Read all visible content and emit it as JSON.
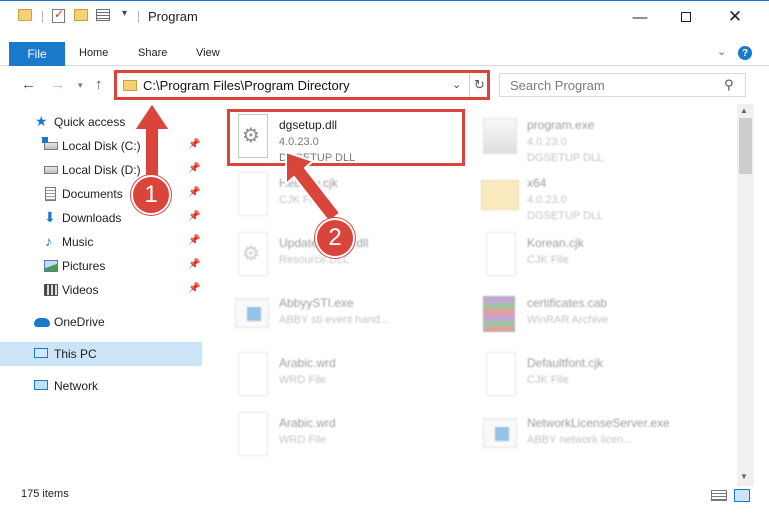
{
  "window": {
    "title": "Program",
    "minimize_glyph": "—",
    "close_glyph": "✕"
  },
  "ribbon": {
    "tabs": [
      "File",
      "Home",
      "Share",
      "View"
    ],
    "help_glyph": "?",
    "collapse_glyph": "⌄"
  },
  "address": {
    "path": "C:\\Program Files\\Program Directory",
    "search_placeholder": "Search Program"
  },
  "nav": {
    "back": "←",
    "forward": "→",
    "up": "↑",
    "items": [
      {
        "label": "Quick access",
        "icon": "star-icon"
      },
      {
        "label": "Local Disk (C:)",
        "icon": "drive-icon",
        "pinned": true
      },
      {
        "label": "Local Disk (D:)",
        "icon": "drive-icon",
        "pinned": true
      },
      {
        "label": "Documents",
        "icon": "documents-icon",
        "pinned": true
      },
      {
        "label": "Downloads",
        "icon": "download-icon",
        "pinned": true
      },
      {
        "label": "Music",
        "icon": "music-icon",
        "pinned": true
      },
      {
        "label": "Pictures",
        "icon": "pictures-icon",
        "pinned": true
      },
      {
        "label": "Videos",
        "icon": "videos-icon",
        "pinned": true
      },
      {
        "label": "OneDrive",
        "icon": "cloud-icon"
      },
      {
        "label": "This PC",
        "icon": "computer-icon",
        "selected": true
      },
      {
        "label": "Network",
        "icon": "network-icon"
      }
    ]
  },
  "files": [
    {
      "name": "dgsetup.dll",
      "line1": "4.0.23.0",
      "line2": "DGSETUP DLL",
      "icon": "dll-icon",
      "highlighted": true
    },
    {
      "name": "program.exe",
      "line1": "4.0.23.0",
      "line2": "DGSETUP DLL",
      "icon": "exe-icon"
    },
    {
      "name": "Hebrew.cjk",
      "line1": "CJK File",
      "line2": "",
      "icon": "file-icon"
    },
    {
      "name": "x64",
      "line1": "4.0.23.0",
      "line2": "DGSETUP DLL",
      "icon": "folder-icon"
    },
    {
      "name": "UpdateCenter.dll",
      "line1": "Resource DLL",
      "line2": "",
      "icon": "dll-icon"
    },
    {
      "name": "Korean.cjk",
      "line1": "CJK File",
      "line2": "",
      "icon": "file-icon"
    },
    {
      "name": "AbbyySTI.exe",
      "line1": "ABBY sti event hand...",
      "line2": "",
      "icon": "app-icon"
    },
    {
      "name": "certificates.cab",
      "line1": "WinRAR Archive",
      "line2": "",
      "icon": "archive-icon"
    },
    {
      "name": "Arabic.wrd",
      "line1": "WRD File",
      "line2": "",
      "icon": "file-icon"
    },
    {
      "name": "Defaultfont.cjk",
      "line1": "CJK File",
      "line2": "",
      "icon": "file-icon"
    },
    {
      "name": "Arabic.wrd",
      "line1": "WRD File",
      "line2": "",
      "icon": "file-icon"
    },
    {
      "name": "NetworkLicenseServer.exe",
      "line1": "ABBY network licen...",
      "line2": "",
      "icon": "app-icon"
    }
  ],
  "status": {
    "item_count": "175 items"
  },
  "callouts": [
    "1",
    "2"
  ],
  "colors": {
    "accent": "#1979ca",
    "annotation_red": "#d9443b",
    "selection": "#cce4f7"
  }
}
